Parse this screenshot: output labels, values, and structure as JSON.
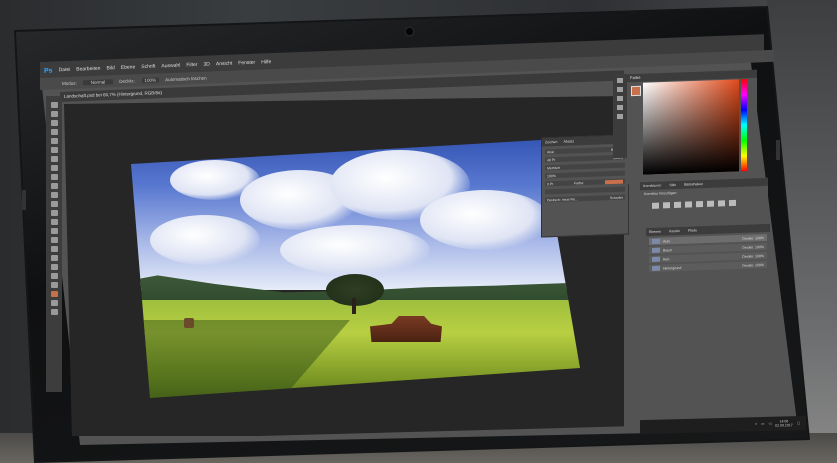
{
  "app": {
    "logo": "Ps",
    "menu": [
      "Datei",
      "Bearbeiten",
      "Bild",
      "Ebene",
      "Schrift",
      "Auswahl",
      "Filter",
      "3D",
      "Ansicht",
      "Fenster",
      "Hilfe"
    ]
  },
  "options_bar": {
    "modus_label": "Modus:",
    "modus_value": "Normal",
    "deckkraft_label": "Deckkr.:",
    "deckkraft_value": "100%",
    "auto_label": "Automatisch löschen"
  },
  "document_tab": {
    "title": "Landschaft.psd bei 66,7% (Hintergrund, RGB/8#)"
  },
  "character_panel": {
    "tabs": [
      "Zeichen",
      "Absatz"
    ],
    "font": "Arial",
    "style": "Regular",
    "size": "48 Pt",
    "leading": "(Auto)",
    "tracking": "Metrisch",
    "scale": "100%",
    "baseline": "0 Pt",
    "color_label": "Farbe:",
    "language": "Deutsch: neue Re...",
    "antialias": "Scharfer"
  },
  "color_panel": {
    "tab": "Farbe",
    "accent": "#c8704a"
  },
  "adjustments_panel": {
    "tabs": [
      "Korrekturen",
      "Stile",
      "Bibliotheken"
    ],
    "hint": "Korrektur hinzufügen"
  },
  "layers_panel": {
    "tabs": [
      "Ebenen",
      "Kanäle",
      "Pfade"
    ],
    "layers": [
      {
        "name": "Auto",
        "opacity": "Deckkr. 100%"
      },
      {
        "name": "Baum",
        "opacity": "Deckkr. 100%"
      },
      {
        "name": "Reh",
        "opacity": "Deckkr. 100%"
      },
      {
        "name": "Hintergrund",
        "opacity": "Deckkr. 100%"
      }
    ]
  },
  "taskbar": {
    "time": "14:06",
    "date": "02.09.2017"
  }
}
